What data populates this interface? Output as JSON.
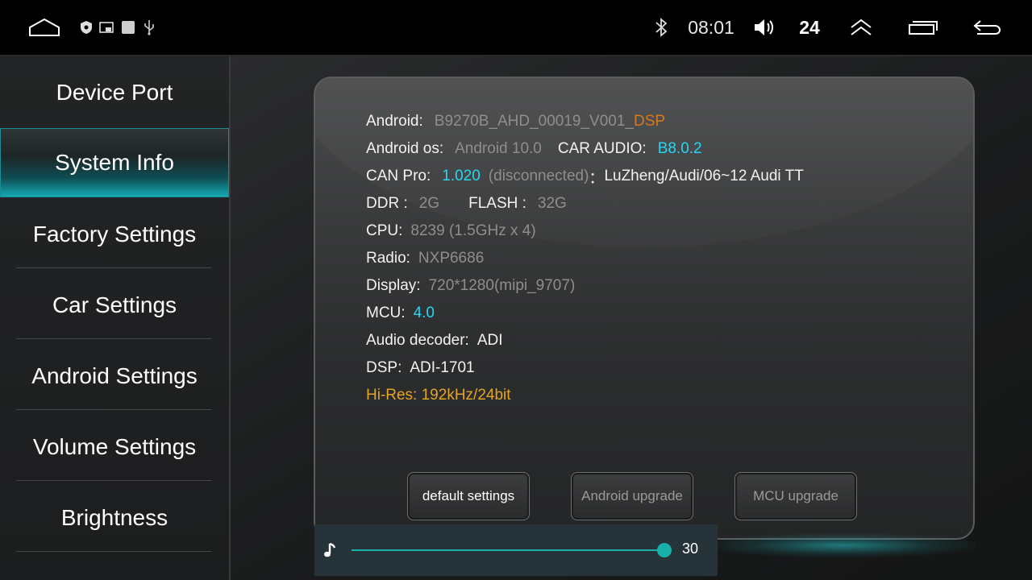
{
  "statusbar": {
    "time": "08:01",
    "volume_level": "24",
    "icons": [
      "home-icon",
      "shield-icon",
      "cast-icon",
      "square-icon",
      "usb-icon",
      "bluetooth-icon",
      "speaker-icon",
      "chevron-up-icon",
      "recent-apps-icon",
      "back-icon"
    ]
  },
  "sidebar": {
    "items": [
      {
        "label": "Device Port"
      },
      {
        "label": "System Info",
        "active": true
      },
      {
        "label": "Factory Settings"
      },
      {
        "label": "Car Settings"
      },
      {
        "label": "Android Settings"
      },
      {
        "label": "Volume Settings"
      },
      {
        "label": "Brightness"
      }
    ]
  },
  "info": {
    "android": {
      "label": "Android:",
      "value": "B9270B_AHD_00019_V001_",
      "suffix": "DSP"
    },
    "android_os": {
      "label": "Android os:",
      "value": "Android 10.0"
    },
    "car_audio": {
      "label": "CAR AUDIO:",
      "value": "B8.0.2"
    },
    "can_pro": {
      "label": "CAN Pro:",
      "value": "1.020",
      "status": "(disconnected)",
      "sep": "：",
      "car": "LuZheng/Audi/06~12 Audi TT"
    },
    "ddr": {
      "label": "DDR :",
      "value": "2G"
    },
    "flash": {
      "label": "FLASH :",
      "value": "32G"
    },
    "cpu": {
      "label": "CPU:",
      "value": "8239 (1.5GHz x 4)"
    },
    "radio": {
      "label": "Radio:",
      "value": "NXP6686"
    },
    "display": {
      "label": "Display:",
      "value": "720*1280(mipi_9707)"
    },
    "mcu": {
      "label": "MCU:",
      "value": "4.0"
    },
    "audio_decoder": {
      "label": "Audio decoder:",
      "value": "ADI"
    },
    "dsp": {
      "label": "DSP:",
      "value": "ADI-1701"
    },
    "hires": "Hi-Res: 192kHz/24bit"
  },
  "buttons": {
    "default_settings": "default settings",
    "android_upgrade": "Android upgrade",
    "mcu_upgrade": "MCU upgrade"
  },
  "volume_overlay": {
    "value": "30",
    "level_fraction": 0.99,
    "accent": "#18b0aa"
  },
  "colors": {
    "cyan_value": "#27d7f0",
    "dsp_orange": "#d37a1e",
    "hires_amber": "#e6a423",
    "active_tab": "#14a9b2"
  }
}
